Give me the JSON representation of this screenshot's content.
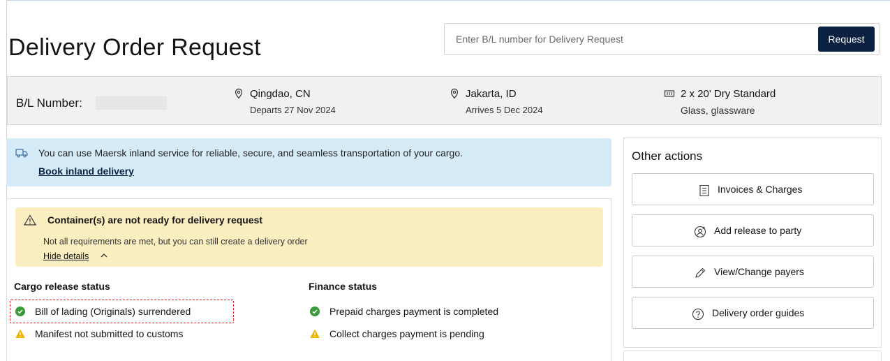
{
  "header": {
    "title": "Delivery Order Request",
    "search_placeholder": "Enter B/L number for Delivery Request",
    "request_button": "Request"
  },
  "bl_bar": {
    "label": "B/L Number:",
    "origin": {
      "city": "Qingdao, CN",
      "detail": "Departs 27 Nov 2024"
    },
    "destination": {
      "city": "Jakarta, ID",
      "detail": "Arrives 5 Dec 2024"
    },
    "cargo": {
      "containers": "2 x 20' Dry Standard",
      "commodity": "Glass, glassware"
    }
  },
  "inland_banner": {
    "text": "You can use Maersk inland service for reliable, secure, and seamless transportation of your cargo.",
    "link": "Book inland delivery"
  },
  "warning": {
    "title": "Container(s) are not ready for delivery request",
    "text": "Not all requirements are met, but you can still create a delivery order",
    "toggle": "Hide details"
  },
  "cargo_release": {
    "title": "Cargo release status",
    "items": [
      {
        "label": "Bill of lading (Originals) surrendered",
        "status": "complete"
      },
      {
        "label": "Manifest not submitted to customs",
        "status": "warning"
      }
    ]
  },
  "finance": {
    "title": "Finance status",
    "items": [
      {
        "label": "Prepaid charges payment is completed",
        "status": "complete"
      },
      {
        "label": "Collect charges payment is pending",
        "status": "warning"
      }
    ]
  },
  "other_actions": {
    "title": "Other actions",
    "buttons": [
      {
        "label": "Invoices & Charges",
        "icon": "invoice-icon"
      },
      {
        "label": "Add release to party",
        "icon": "add-person-icon"
      },
      {
        "label": "View/Change payers",
        "icon": "pencil-icon"
      },
      {
        "label": "Delivery order guides",
        "icon": "help-icon"
      }
    ]
  },
  "colors": {
    "primary": "#0b2141",
    "info_bg": "#d6ebf8",
    "warning_bg": "#fbeec0",
    "success": "#3a9a3a",
    "warning": "#f0b400",
    "highlight": "#e0191d"
  }
}
